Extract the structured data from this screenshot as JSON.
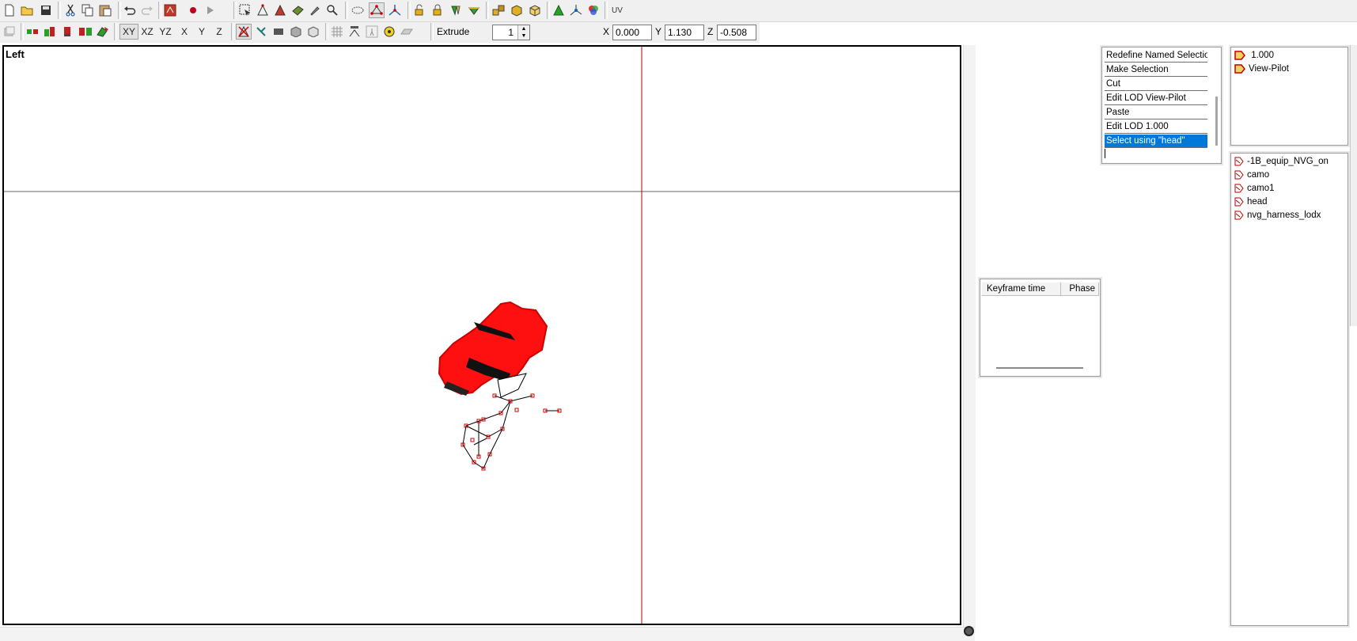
{
  "toolbar": {
    "axis_buttons": [
      "XY",
      "XZ",
      "YZ",
      "X",
      "Y",
      "Z"
    ],
    "uv_label": "UV",
    "extrude_label": "Extrude",
    "extrude_value": "1",
    "coords": {
      "x_label": "X",
      "x_value": "0.000",
      "y_label": "Y",
      "y_value": "1.130",
      "z_label": "Z",
      "z_value": "-0.508"
    }
  },
  "viewport": {
    "label": "Left"
  },
  "history": {
    "items": [
      "Redefine Named Selection",
      "Make Selection",
      "Cut",
      "Edit LOD View-Pilot",
      "Paste",
      "Edit LOD   1.000",
      "Select using \"head\""
    ],
    "selected_index": 6
  },
  "lods": [
    "  1.000",
    "View-Pilot"
  ],
  "selections": [
    "-1B_equip_NVG_on",
    "camo",
    "camo1",
    "head",
    "nvg_harness_lodx"
  ],
  "keyframe": {
    "col_time": "Keyframe time",
    "col_phase": "Phase"
  },
  "colors": {
    "selection_red": "#ff0000",
    "accent_blue": "#0078d7",
    "axis_line": "#b00000"
  }
}
